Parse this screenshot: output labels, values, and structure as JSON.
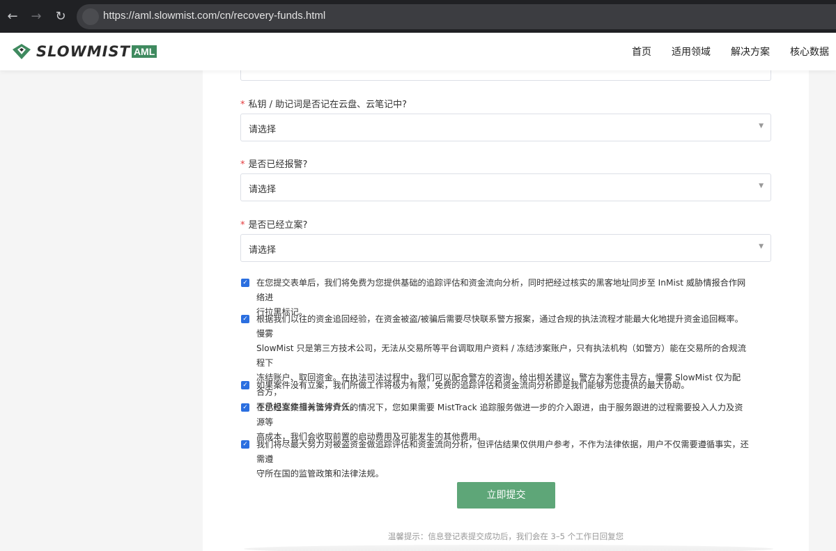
{
  "browser": {
    "url": "https://aml.slowmist.com/cn/recovery-funds.html"
  },
  "header": {
    "logo_text": "SLOWMIST",
    "logo_badge": "AML",
    "nav": [
      "首页",
      "适用领域",
      "解决方案",
      "核心数据"
    ]
  },
  "form": {
    "questions": [
      {
        "label": "私钥 / 助记词是否记在云盘、云笔记中?",
        "placeholder": "请选择"
      },
      {
        "label": "是否已经报警?",
        "placeholder": "请选择"
      },
      {
        "label": "是否已经立案?",
        "placeholder": "请选择"
      }
    ],
    "agreements": [
      {
        "lines": [
          "在您提交表单后，我们将免费为您提供基础的追踪评估和资金流向分析，同时把经过核实的黑客地址同步至 InMist 威胁情报合作网络进",
          "行拉黑标记。"
        ]
      },
      {
        "lines": [
          "根据我们以往的资金追回经验，在资金被盗/被骗后需要尽快联系警方报案，通过合规的执法流程才能最大化地提升资金追回概率。慢雾",
          "SlowMist 只是第三方技术公司，无法从交易所等平台调取用户资料 / 冻结涉案账户，只有执法机构（如警方）能在交易所的合规流程下",
          "冻结账户、取回资金。在执法司法过程中，我们可以配合警方的咨询，给出相关建议，警方为案件主导方，慢雾 SlowMist 仅为配合方，",
          "不承担案件相关法律责任。"
        ]
      },
      {
        "lines": [
          "如果案件没有立案，我们所做工作将极为有限，免费的追踪评估和资金流向分析即是我们能够为您提供的最大协助。"
        ]
      },
      {
        "lines": [
          "在已经立案且有警方介入的情况下，您如果需要 MistTrack 追踪服务做进一步的介入跟进，由于服务跟进的过程需要投入人力及资源等",
          "高成本，我们会收取前置的启动费用及可能发生的其他费用。"
        ]
      },
      {
        "lines": [
          "我们将尽最大努力对被盗资金做追踪评估和资金流向分析，但评估结果仅供用户参考，不作为法律依据，用户不仅需要遵循事实，还需遵",
          "守所在国的监管政策和法律法规。"
        ]
      }
    ],
    "submit_label": "立即提交",
    "tip": "温馨提示：信息登记表提交成功后，我们会在 3–5 个工作日回复您"
  },
  "colors": {
    "accent_green": "#5ea678",
    "checkbox_blue": "#2b6fe0",
    "required_red": "#e4393c"
  }
}
